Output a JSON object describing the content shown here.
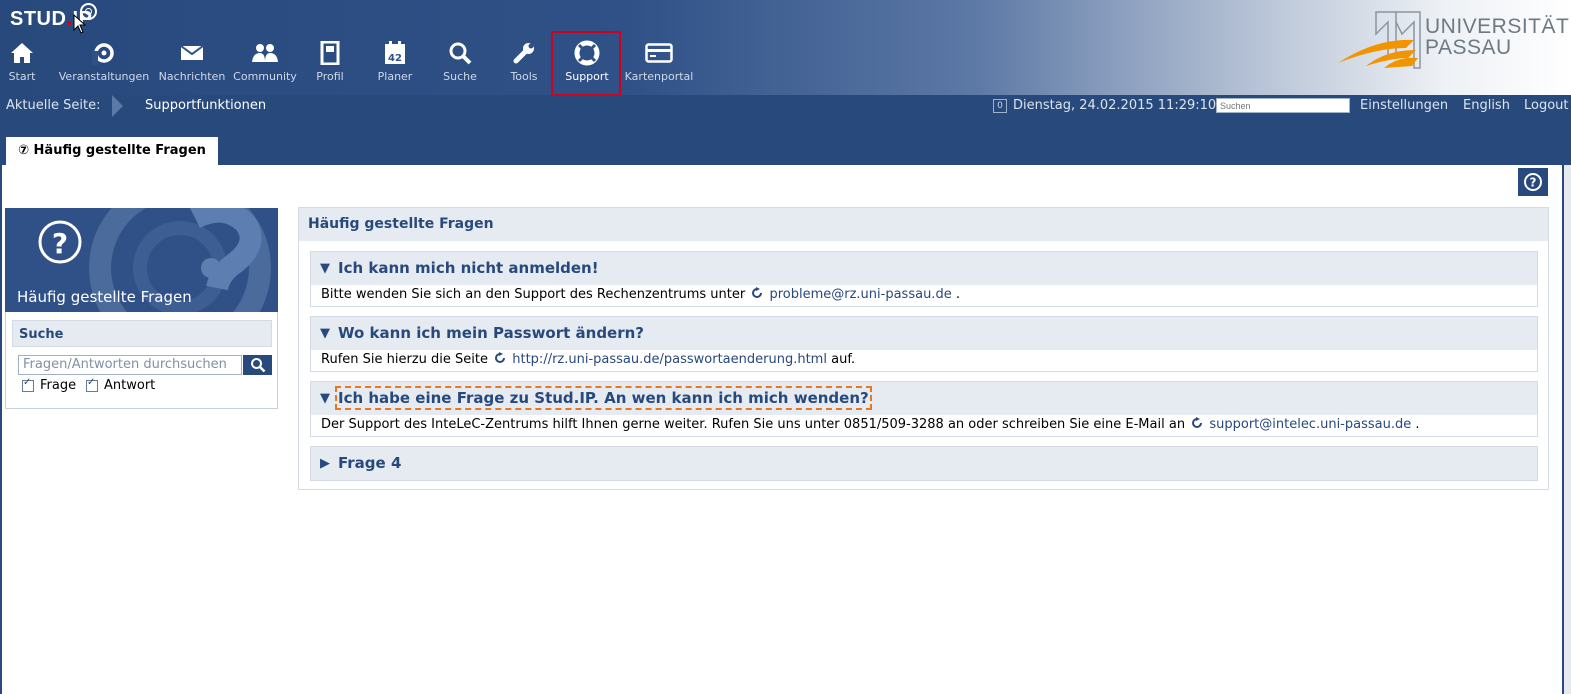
{
  "app": {
    "logo_text": "STUD.IP"
  },
  "nav": [
    {
      "label": "Start",
      "icon": "home-icon"
    },
    {
      "label": "Veranstaltungen",
      "icon": "seminar-icon"
    },
    {
      "label": "Nachrichten",
      "icon": "mail-icon"
    },
    {
      "label": "Community",
      "icon": "community-icon"
    },
    {
      "label": "Profil",
      "icon": "profile-icon"
    },
    {
      "label": "Planer",
      "icon": "calendar-icon"
    },
    {
      "label": "Suche",
      "icon": "search-icon"
    },
    {
      "label": "Tools",
      "icon": "wrench-icon"
    },
    {
      "label": "Support",
      "icon": "lifebuoy-icon",
      "active": true
    },
    {
      "label": "Kartenportal",
      "icon": "card-icon"
    }
  ],
  "university": {
    "line1": "UNIVERSITÄT",
    "line2": "PASSAU"
  },
  "breadcrumb": {
    "label": "Aktuelle Seite:",
    "page": "Supportfunktionen"
  },
  "topbar": {
    "badge": "0",
    "datetime": "Dienstag, 24.02.2015 11:29:10",
    "search_placeholder": "Suchen",
    "settings": "Einstellungen",
    "language": "English",
    "logout": "Logout"
  },
  "tabs": {
    "active": "Häufig gestellte Fragen"
  },
  "sidebar": {
    "title": "Häufig gestellte Fragen",
    "search_title": "Suche",
    "search_placeholder": "Fragen/Antworten durchsuchen",
    "checkbox_question": "Frage",
    "checkbox_answer": "Antwort"
  },
  "content": {
    "title": "Häufig gestellte Fragen",
    "faqs": [
      {
        "question": "Ich kann mich nicht anmelden!",
        "answer_before": "Bitte wenden Sie sich an den Support des Rechenzentrums unter",
        "link": "probleme@rz.uni-passau.de",
        "answer_after": "."
      },
      {
        "question": "Wo kann ich mein Passwort ändern?",
        "answer_before": "Rufen Sie hierzu die Seite",
        "link": "http://rz.uni-passau.de/passwortaenderung.html",
        "answer_after": "auf."
      },
      {
        "question": "Ich habe eine Frage zu Stud.IP. An wen kann ich mich wenden?",
        "answer_before": "Der Support des InteLeC-Zentrums hilft Ihnen gerne weiter. Rufen Sie uns unter 0851/509-3288 an oder schreiben Sie eine E-Mail an",
        "link": "support@intelec.uni-passau.de",
        "answer_after": "."
      },
      {
        "question": "Frage 4"
      }
    ]
  },
  "colors": {
    "brand": "#28497c",
    "highlight": "#d0021b",
    "focus": "#e87722",
    "panel": "#e6ebf2"
  }
}
